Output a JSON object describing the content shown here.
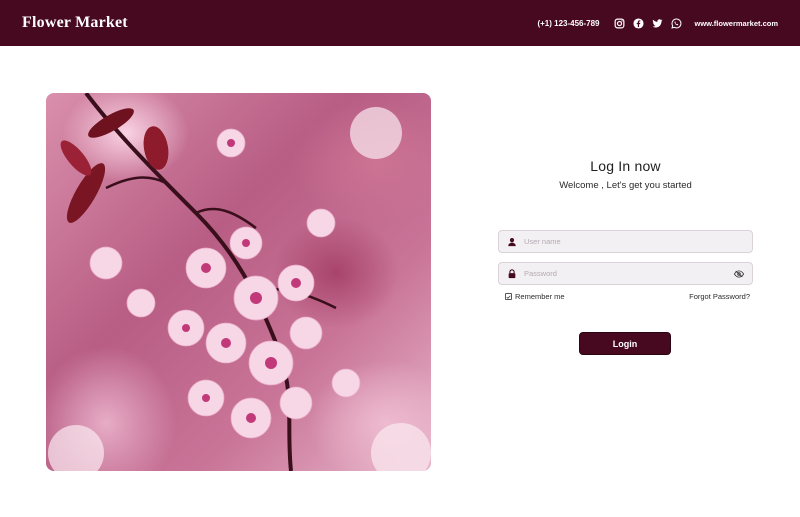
{
  "header": {
    "brand": "Flower Market",
    "phone": "(+1) 123-456-789",
    "social_icons": [
      "instagram-icon",
      "facebook-icon",
      "twitter-icon",
      "whatsapp-icon"
    ],
    "website": "www.flowermarket.com"
  },
  "hero": {
    "image": "cherry-blossom-photo"
  },
  "login": {
    "title": "Log In now",
    "subtitle": "Welcome , Let's get you started",
    "username_placeholder": "User name",
    "username_value": "",
    "password_placeholder": "Password",
    "password_value": "",
    "remember_label": "Remember me",
    "remember_checked": true,
    "forgot_label": "Forgot Password?",
    "submit_label": "Login"
  },
  "colors": {
    "brand": "#47091f",
    "field_bg": "#f3f0f3",
    "page_bg": "#ffffff"
  }
}
